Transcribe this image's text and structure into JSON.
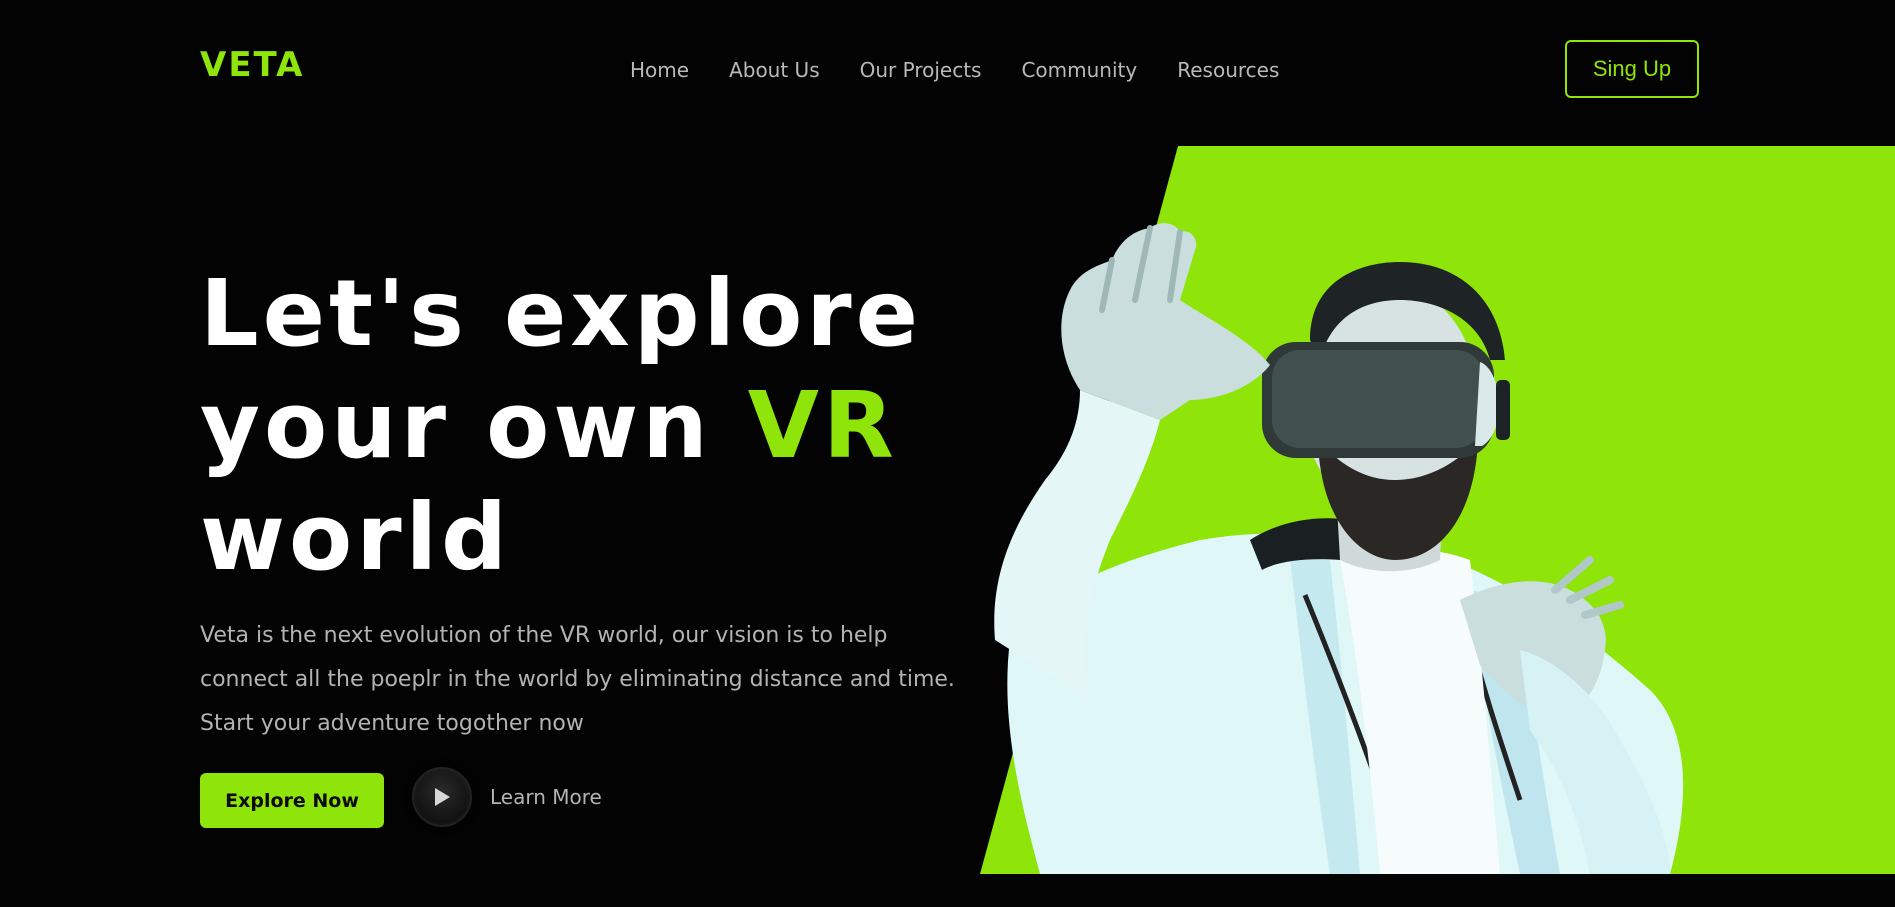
{
  "header": {
    "logo": "VETA",
    "nav": [
      "Home",
      "About Us",
      "Our Projects",
      "Community",
      "Resources"
    ],
    "signup_label": "Sing Up"
  },
  "hero": {
    "headline_line1": "Let's explore",
    "headline_line2_prefix": "your own ",
    "headline_line2_accent": "VR",
    "headline_line3": "world",
    "description": "Veta is the next evolution of the VR world, our vision is to help connect all the poeplr in the world by eliminating distance and time. Start your adventure togother now",
    "explore_label": "Explore Now",
    "learn_more_label": "Learn More",
    "image_subject": "man-wearing-vr-headset"
  },
  "colors": {
    "accent": "#8fe40a",
    "background": "#030303",
    "muted_text": "#b3b3b3"
  },
  "icons": {
    "play": "play-icon"
  }
}
